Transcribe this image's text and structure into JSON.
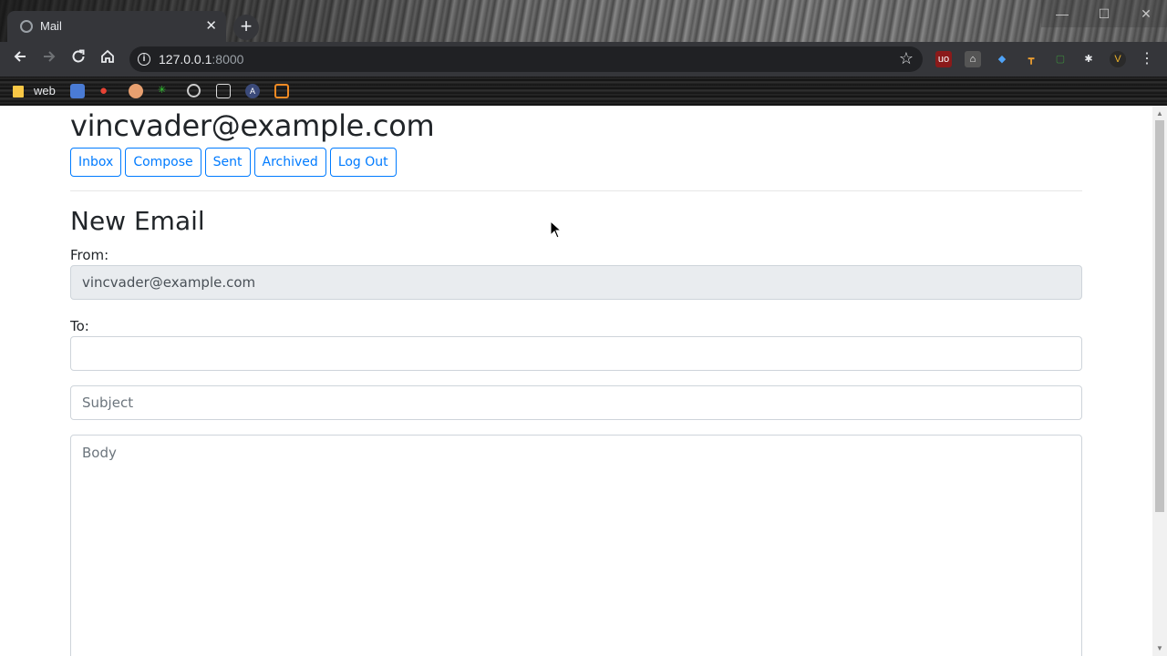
{
  "browser": {
    "tab_title": "Mail",
    "tab_close": "✕",
    "new_tab": "+",
    "url_host": "127.0.0.1",
    "url_port": ":8000",
    "window_controls": [
      "—",
      "☐",
      "✕"
    ],
    "bookmarks": {
      "folder_label": "web"
    },
    "icons": {
      "back": "arrow-left-icon",
      "forward": "arrow-right-icon",
      "reload": "reload-icon",
      "home": "home-icon",
      "info": "info-icon",
      "star": "star-icon",
      "extensions": "puzzle-icon",
      "menu": "kebab-menu-icon"
    }
  },
  "mail": {
    "user_email": "vincvader@example.com",
    "nav": {
      "inbox": "Inbox",
      "compose": "Compose",
      "sent": "Sent",
      "archived": "Archived",
      "logout": "Log Out"
    },
    "compose": {
      "title": "New Email",
      "from_label": "From:",
      "from_value": "vincvader@example.com",
      "to_label": "To:",
      "to_value": "",
      "subject_placeholder": "Subject",
      "body_placeholder": "Body"
    },
    "colors": {
      "primary": "#007bff",
      "text": "#212529",
      "disabled_bg": "#e9ecef",
      "border": "#ced4da"
    }
  }
}
